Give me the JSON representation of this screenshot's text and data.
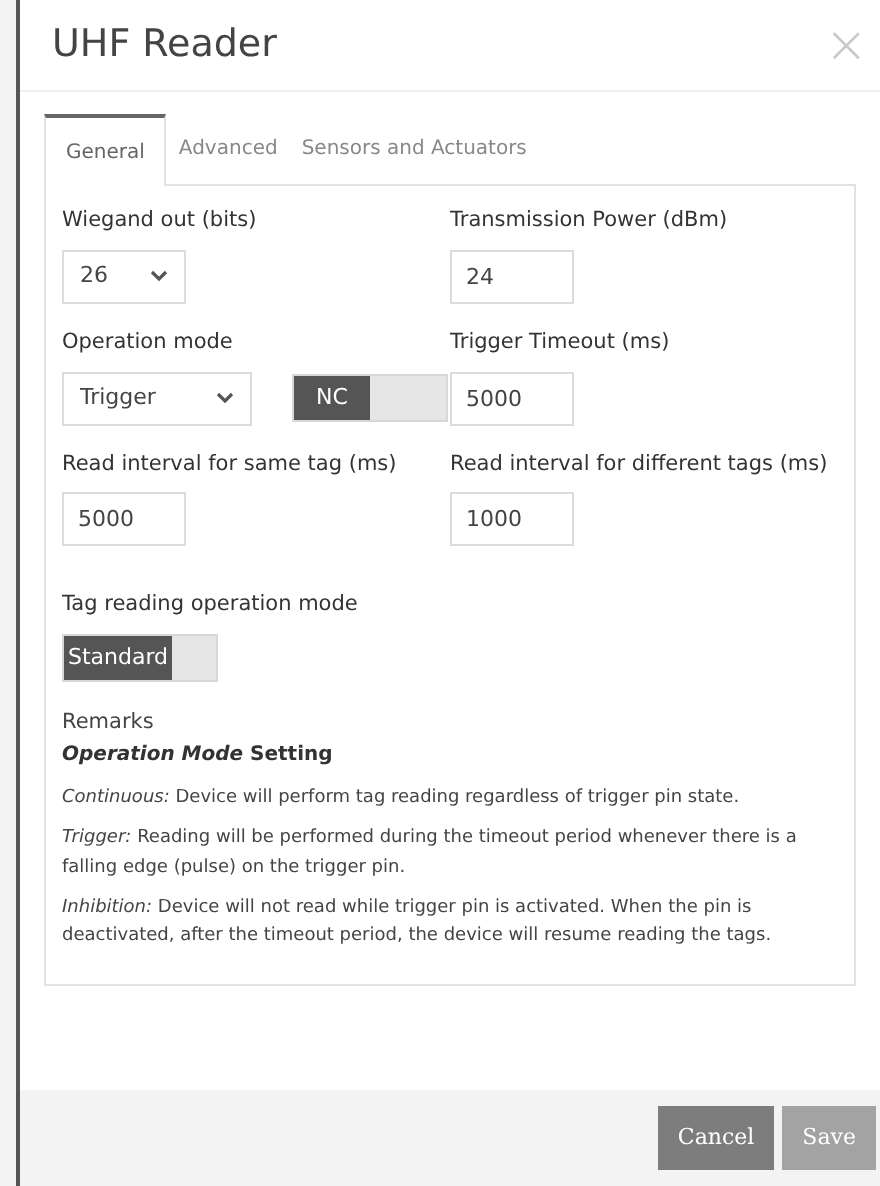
{
  "dialog": {
    "title": "UHF Reader",
    "close": "×"
  },
  "tabs": [
    {
      "label": "General",
      "selected": true
    },
    {
      "label": "Advanced",
      "selected": false
    },
    {
      "label": "Sensors and Actuators",
      "selected": false
    }
  ],
  "rows": [
    [
      {
        "label": "Wiegand out (bits)",
        "kind": "select",
        "value": "26"
      },
      {
        "label": "Transmission Power (dBm)",
        "kind": "input",
        "value": "24"
      }
    ],
    [
      {
        "label": "Operation mode",
        "kind": "select_toggle",
        "value": "Trigger",
        "toggle": {
          "label": "NC",
          "on": true
        }
      },
      {
        "label": "Trigger Timeout (ms)",
        "kind": "input",
        "value": "5000"
      }
    ],
    [
      {
        "label": "Read interval for same tag (ms)",
        "kind": "input",
        "value": "5000"
      },
      {
        "label": "Read interval for different tags (ms)",
        "kind": "input",
        "value": "1000"
      }
    ],
    [
      {
        "label": "Tag reading operation mode",
        "kind": "toggle",
        "toggle": {
          "label": "Standard",
          "on": true
        }
      }
    ]
  ],
  "remarks": {
    "title": "Remarks",
    "heading": "*Operation Mode* Setting",
    "paragraphs": [
      "*Continuous:* Device will perform tag reading regardless of trigger pin state.",
      "*Trigger:* Reading will be performed during the timeout period whenever there is a falling edge (pulse) on the trigger pin.",
      "*Inhibition:* Device will not read while trigger pin is activated. When the pin is deactivated, after the timeout period, the device will resume reading the tags."
    ]
  },
  "buttons": [
    {
      "label": "Cancel",
      "kind": "secondary"
    },
    {
      "label": "Save",
      "kind": "primary"
    }
  ]
}
